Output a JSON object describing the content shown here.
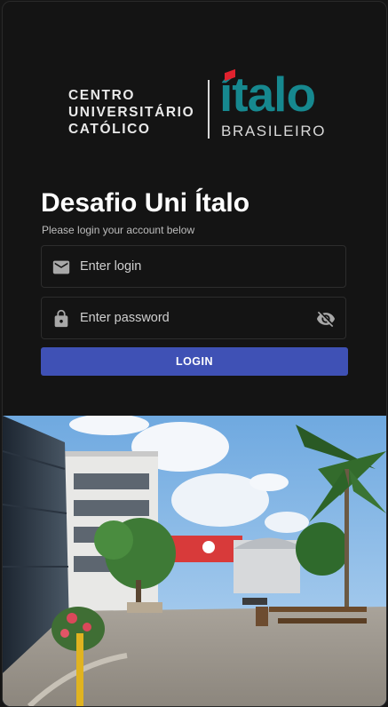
{
  "logo": {
    "line1": "CENTRO",
    "line2": "UNIVERSITÁRIO",
    "line3": "CATÓLICO",
    "brand": "ítalo",
    "brand_sub": "BRASILEIRO"
  },
  "form": {
    "title": "Desafio Uni Ítalo",
    "subtitle": "Please login your account below",
    "login_placeholder": "Enter login",
    "password_placeholder": "Enter password",
    "login_button": "LOGIN"
  },
  "colors": {
    "background": "#141414",
    "button": "#3f51b5",
    "brand_teal": "#16888f",
    "brand_red": "#e0222e"
  },
  "icons": {
    "login": "email-icon",
    "password": "lock-icon",
    "toggle": "eye-off-icon"
  }
}
